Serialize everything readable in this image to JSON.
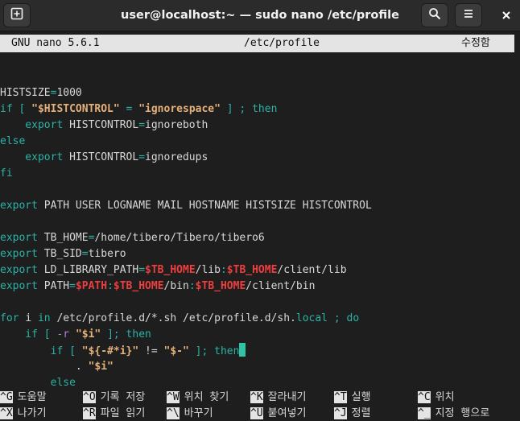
{
  "window": {
    "title": "user@localhost:~ — sudo nano /etc/profile"
  },
  "nano": {
    "header_version": "GNU nano 5.6.1",
    "header_file": "/etc/profile",
    "header_status": "수정함"
  },
  "colors": {
    "default_text": "#d8d8d8",
    "keyword": "#2bb3a6",
    "operator": "#2bb3a6",
    "string": "#e0b48a",
    "string_bold": "#e6b07a",
    "variable": "#ef3e3e",
    "flag": "#b07fd6",
    "comment_path": "#7f8f8f",
    "cursor": "#2ec4a6",
    "header_bg": "#e4e4e4"
  },
  "editor": {
    "lines": [
      [],
      [
        {
          "t": "HISTSIZE",
          "c": "default_text"
        },
        {
          "t": "=",
          "c": "operator"
        },
        {
          "t": "1000",
          "c": "default_text"
        }
      ],
      [
        {
          "t": "if [ ",
          "c": "keyword"
        },
        {
          "t": "\"$HISTCONTROL\"",
          "c": "string_bold"
        },
        {
          "t": " = ",
          "c": "keyword"
        },
        {
          "t": "\"ignorespace\"",
          "c": "string_bold"
        },
        {
          "t": " ] ; then",
          "c": "keyword"
        }
      ],
      [
        {
          "t": "    export ",
          "c": "keyword"
        },
        {
          "t": "HISTCONTROL",
          "c": "default_text"
        },
        {
          "t": "=",
          "c": "operator"
        },
        {
          "t": "ignoreboth",
          "c": "default_text"
        }
      ],
      [
        {
          "t": "else",
          "c": "keyword"
        }
      ],
      [
        {
          "t": "    export ",
          "c": "keyword"
        },
        {
          "t": "HISTCONTROL",
          "c": "default_text"
        },
        {
          "t": "=",
          "c": "operator"
        },
        {
          "t": "ignoredups",
          "c": "default_text"
        }
      ],
      [
        {
          "t": "fi",
          "c": "keyword"
        }
      ],
      [],
      [
        {
          "t": "export ",
          "c": "keyword"
        },
        {
          "t": "PATH USER LOGNAME MAIL HOSTNAME HISTSIZE HISTCONTROL",
          "c": "default_text"
        }
      ],
      [],
      [
        {
          "t": "export ",
          "c": "keyword"
        },
        {
          "t": "TB_HOME",
          "c": "default_text"
        },
        {
          "t": "=",
          "c": "operator"
        },
        {
          "t": "/home/tibero/Tibero/tibero6",
          "c": "default_text"
        }
      ],
      [
        {
          "t": "export ",
          "c": "keyword"
        },
        {
          "t": "TB_SID",
          "c": "default_text"
        },
        {
          "t": "=",
          "c": "operator"
        },
        {
          "t": "tibero",
          "c": "default_text"
        }
      ],
      [
        {
          "t": "export ",
          "c": "keyword"
        },
        {
          "t": "LD_LIBRARY_PATH",
          "c": "default_text"
        },
        {
          "t": "=",
          "c": "operator"
        },
        {
          "t": "$TB_HOME",
          "c": "variable"
        },
        {
          "t": "/lib",
          "c": "default_text"
        },
        {
          "t": ":",
          "c": "operator"
        },
        {
          "t": "$TB_HOME",
          "c": "variable"
        },
        {
          "t": "/client/lib",
          "c": "default_text"
        }
      ],
      [
        {
          "t": "export ",
          "c": "keyword"
        },
        {
          "t": "PATH",
          "c": "default_text"
        },
        {
          "t": "=",
          "c": "operator"
        },
        {
          "t": "$PATH",
          "c": "variable"
        },
        {
          "t": ":",
          "c": "operator"
        },
        {
          "t": "$TB_HOME",
          "c": "variable"
        },
        {
          "t": "/bin",
          "c": "default_text"
        },
        {
          "t": ":",
          "c": "operator"
        },
        {
          "t": "$TB_HOME",
          "c": "variable"
        },
        {
          "t": "/client/bin",
          "c": "default_text"
        }
      ],
      [],
      [
        {
          "t": "for ",
          "c": "keyword"
        },
        {
          "t": "i ",
          "c": "default_text"
        },
        {
          "t": "in ",
          "c": "keyword"
        },
        {
          "t": "/etc/profile.d/*.sh /etc/profile.d/sh.",
          "c": "default_text"
        },
        {
          "t": "local",
          "c": "keyword"
        },
        {
          "t": " ; do",
          "c": "keyword"
        }
      ],
      [
        {
          "t": "    if [ ",
          "c": "keyword"
        },
        {
          "t": "-r ",
          "c": "flag"
        },
        {
          "t": "\"$i\"",
          "c": "string_bold"
        },
        {
          "t": " ]; then",
          "c": "keyword"
        }
      ],
      [
        {
          "t": "        if [ ",
          "c": "keyword"
        },
        {
          "t": "\"${-#*i}\"",
          "c": "string_bold"
        },
        {
          "t": " != ",
          "c": "default_text"
        },
        {
          "t": "\"$-\"",
          "c": "string_bold"
        },
        {
          "t": " ]; then",
          "c": "keyword"
        },
        {
          "t": "",
          "c": "cursor"
        }
      ],
      [
        {
          "t": "            . ",
          "c": "default_text"
        },
        {
          "t": "\"$i\"",
          "c": "string_bold"
        }
      ],
      [
        {
          "t": "        else",
          "c": "keyword"
        }
      ]
    ]
  },
  "shortcuts": [
    {
      "key": "^G",
      "label": "도움말"
    },
    {
      "key": "^O",
      "label": "기록 저장"
    },
    {
      "key": "^W",
      "label": "위치 찾기"
    },
    {
      "key": "^K",
      "label": "잘라내기"
    },
    {
      "key": "^T",
      "label": "실행"
    },
    {
      "key": "^C",
      "label": "위치"
    },
    {
      "key": "^X",
      "label": "나가기"
    },
    {
      "key": "^R",
      "label": "파일 읽기"
    },
    {
      "key": "^\\",
      "label": "바꾸기"
    },
    {
      "key": "^U",
      "label": "붙여넣기"
    },
    {
      "key": "^J",
      "label": "정렬"
    },
    {
      "key": "^_",
      "label": "지정 행으로"
    }
  ],
  "icons": {
    "new_tab": "new-tab-icon",
    "search": "search-icon",
    "menu": "hamburger-menu-icon",
    "close": "close-icon"
  }
}
